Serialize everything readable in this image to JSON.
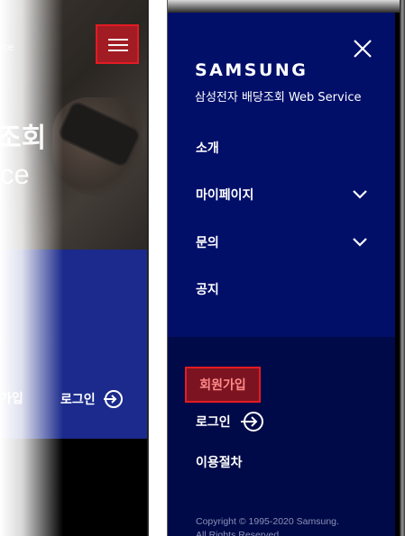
{
  "left_screen": {
    "hero_small_text": "ice",
    "hero_title": "조회",
    "hero_subtitle": "ce",
    "join_label": "가입",
    "login_label": "로그인",
    "icons": {
      "menu": "hamburger-icon",
      "login": "login-arrow-icon"
    }
  },
  "menu": {
    "brand": "SAMSUNG",
    "tagline": "삼성전자 배당조회 Web Service",
    "items": [
      {
        "label": "소개",
        "expandable": false
      },
      {
        "label": "마이페이지",
        "expandable": true
      },
      {
        "label": "문의",
        "expandable": true
      },
      {
        "label": "공지",
        "expandable": false
      }
    ],
    "signup_label": "회원가입",
    "login_label": "로그인",
    "process_label": "이용절차",
    "copyright_line1": "Copyright © 1995-2020 Samsung.",
    "copyright_line2": "All Rights Reserved.",
    "icons": {
      "close": "close-icon",
      "chevron": "chevron-down-icon",
      "login": "login-arrow-icon"
    }
  },
  "colors": {
    "menu_bg": "#010f69",
    "menu_bottom_bg": "#010a48",
    "highlight_border": "#e31b23",
    "highlight_fill": "#a11c23",
    "left_band": "#1b2a8c"
  }
}
